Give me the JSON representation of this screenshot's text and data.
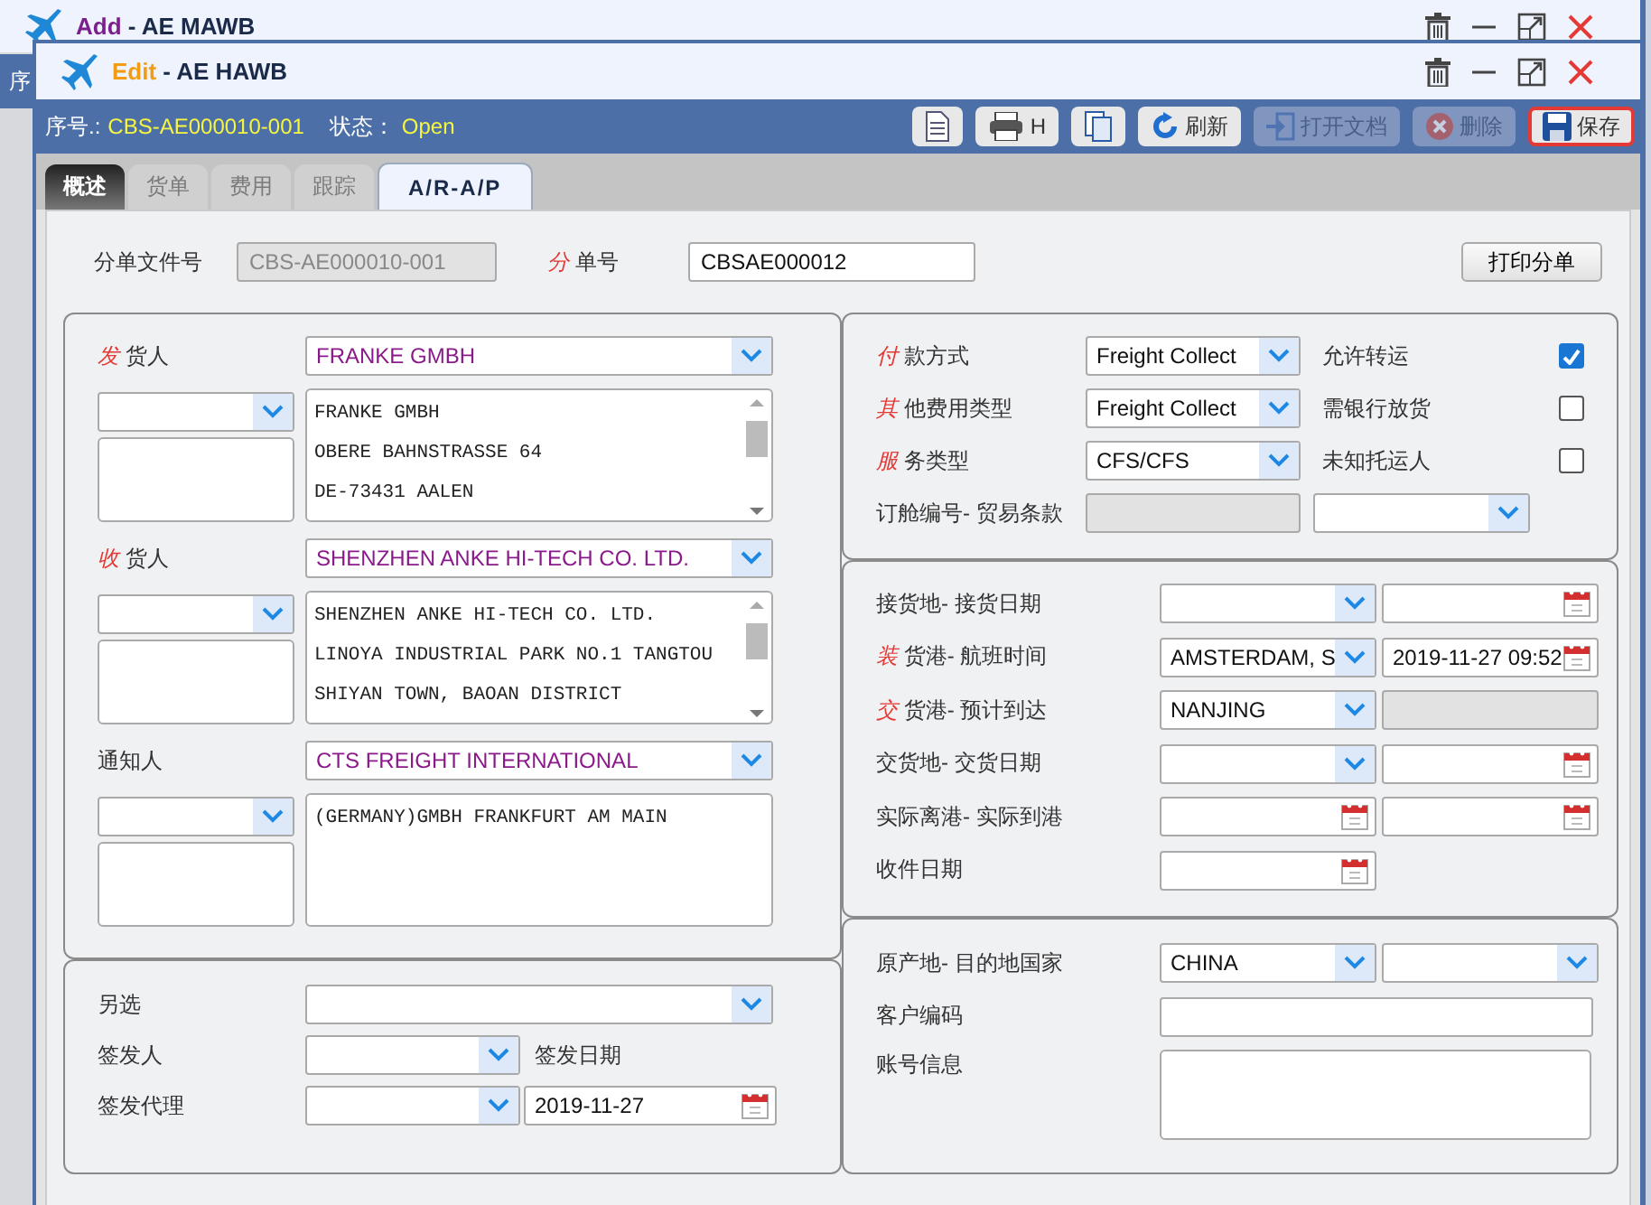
{
  "background_window": {
    "kind": "add",
    "mode": "Add",
    "title": "- AE MAWB",
    "header_label": "序"
  },
  "window": {
    "kind": "edit",
    "mode": "Edit",
    "title": "- AE HAWB"
  },
  "header": {
    "serial_label": "序号.:",
    "serial": "CBS-AE000010-001",
    "status_label": "状态：",
    "status": "Open"
  },
  "toolbar": [
    {
      "kind": "document",
      "disabled": false,
      "highlighted": false
    },
    {
      "kind": "print",
      "text": "H",
      "disabled": false,
      "highlighted": false
    },
    {
      "kind": "copy",
      "disabled": false,
      "highlighted": false
    },
    {
      "kind": "refresh",
      "text": "刷新",
      "disabled": false,
      "highlighted": false
    },
    {
      "kind": "open",
      "text": "打开文档",
      "disabled": true,
      "highlighted": false
    },
    {
      "kind": "delete",
      "text": "删除",
      "disabled": true,
      "highlighted": false
    },
    {
      "kind": "save",
      "text": "保存",
      "disabled": false,
      "highlighted": true
    }
  ],
  "tabs": [
    {
      "label": "概述",
      "selected": false,
      "disabled": false,
      "highlighted": true
    },
    {
      "label": "货单",
      "selected": false,
      "disabled": true,
      "highlighted": false
    },
    {
      "label": "费用",
      "selected": false,
      "disabled": true,
      "highlighted": false
    },
    {
      "label": "跟踪",
      "selected": false,
      "disabled": true,
      "highlighted": false
    },
    {
      "label": "A/R-A/P",
      "selected": true,
      "disabled": false,
      "highlighted": false
    }
  ],
  "top_row": {
    "file_label": "分单文件号",
    "file_value": "CBS-AE000010-001",
    "hawb_mark": "分",
    "hawb_label": "单号",
    "hawb_value": "CBSAE000012",
    "print_button": "打印分单"
  },
  "parties": [
    {
      "mark": "发",
      "label": "货人",
      "name": "FRANKE GMBH",
      "address": [
        "FRANKE GMBH",
        "OBERE BAHNSTRASSE 64",
        "DE-73431 AALEN"
      ]
    },
    {
      "mark": "收",
      "label": "货人",
      "name": "SHENZHEN ANKE HI-TECH CO. LTD.",
      "address": [
        "SHENZHEN ANKE HI-TECH CO. LTD.",
        "LINOYA INDUSTRIAL PARK NO.1 TANGTOU",
        "SHIYAN TOWN, BAOAN DISTRICT"
      ]
    },
    {
      "label": "通知人",
      "name": "CTS FREIGHT INTERNATIONAL",
      "address": [
        "(GERMANY)GMBH FRANKFURT AM MAIN"
      ]
    }
  ],
  "issue": {
    "alt_label": "另选",
    "issuer_label": "签发人",
    "issue_date_label": "签发日期",
    "agent_label": "签发代理",
    "issue_date": "2019-11-27"
  },
  "terms": [
    {
      "kind": "select",
      "mark": "付",
      "label": "款方式",
      "value": "Freight Collect"
    },
    {
      "kind": "select",
      "mark": "其",
      "label": "他费用类型",
      "value": "Freight Collect"
    },
    {
      "kind": "select",
      "mark": "服",
      "label": "务类型",
      "value": "CFS/CFS"
    },
    {
      "kind": "booking",
      "label": "订舱编号- 贸易条款"
    }
  ],
  "options": [
    {
      "label": "允许转运",
      "checked": true
    },
    {
      "label": "需银行放货",
      "checked": false
    },
    {
      "label": "未知托运人",
      "checked": false
    }
  ],
  "routing": [
    {
      "kind": "select-date",
      "label": "接货地- 接货日期"
    },
    {
      "kind": "select-date",
      "mark": "装",
      "label": "货港- 航班时间",
      "place": "AMSTERDAM, S",
      "date": "2019-11-27 09:52"
    },
    {
      "kind": "select-disabled",
      "mark": "交",
      "label": "货港- 预计到达",
      "place": "NANJING"
    },
    {
      "kind": "select-date",
      "label": "交货地- 交货日期"
    },
    {
      "kind": "date-date",
      "label": "实际离港- 实际到港"
    },
    {
      "kind": "date",
      "label": "收件日期"
    }
  ],
  "destination": {
    "country_label": "原产地- 目的地国家",
    "origin": "CHINA",
    "customer_label": "客户编码",
    "account_label": "账号信息"
  }
}
